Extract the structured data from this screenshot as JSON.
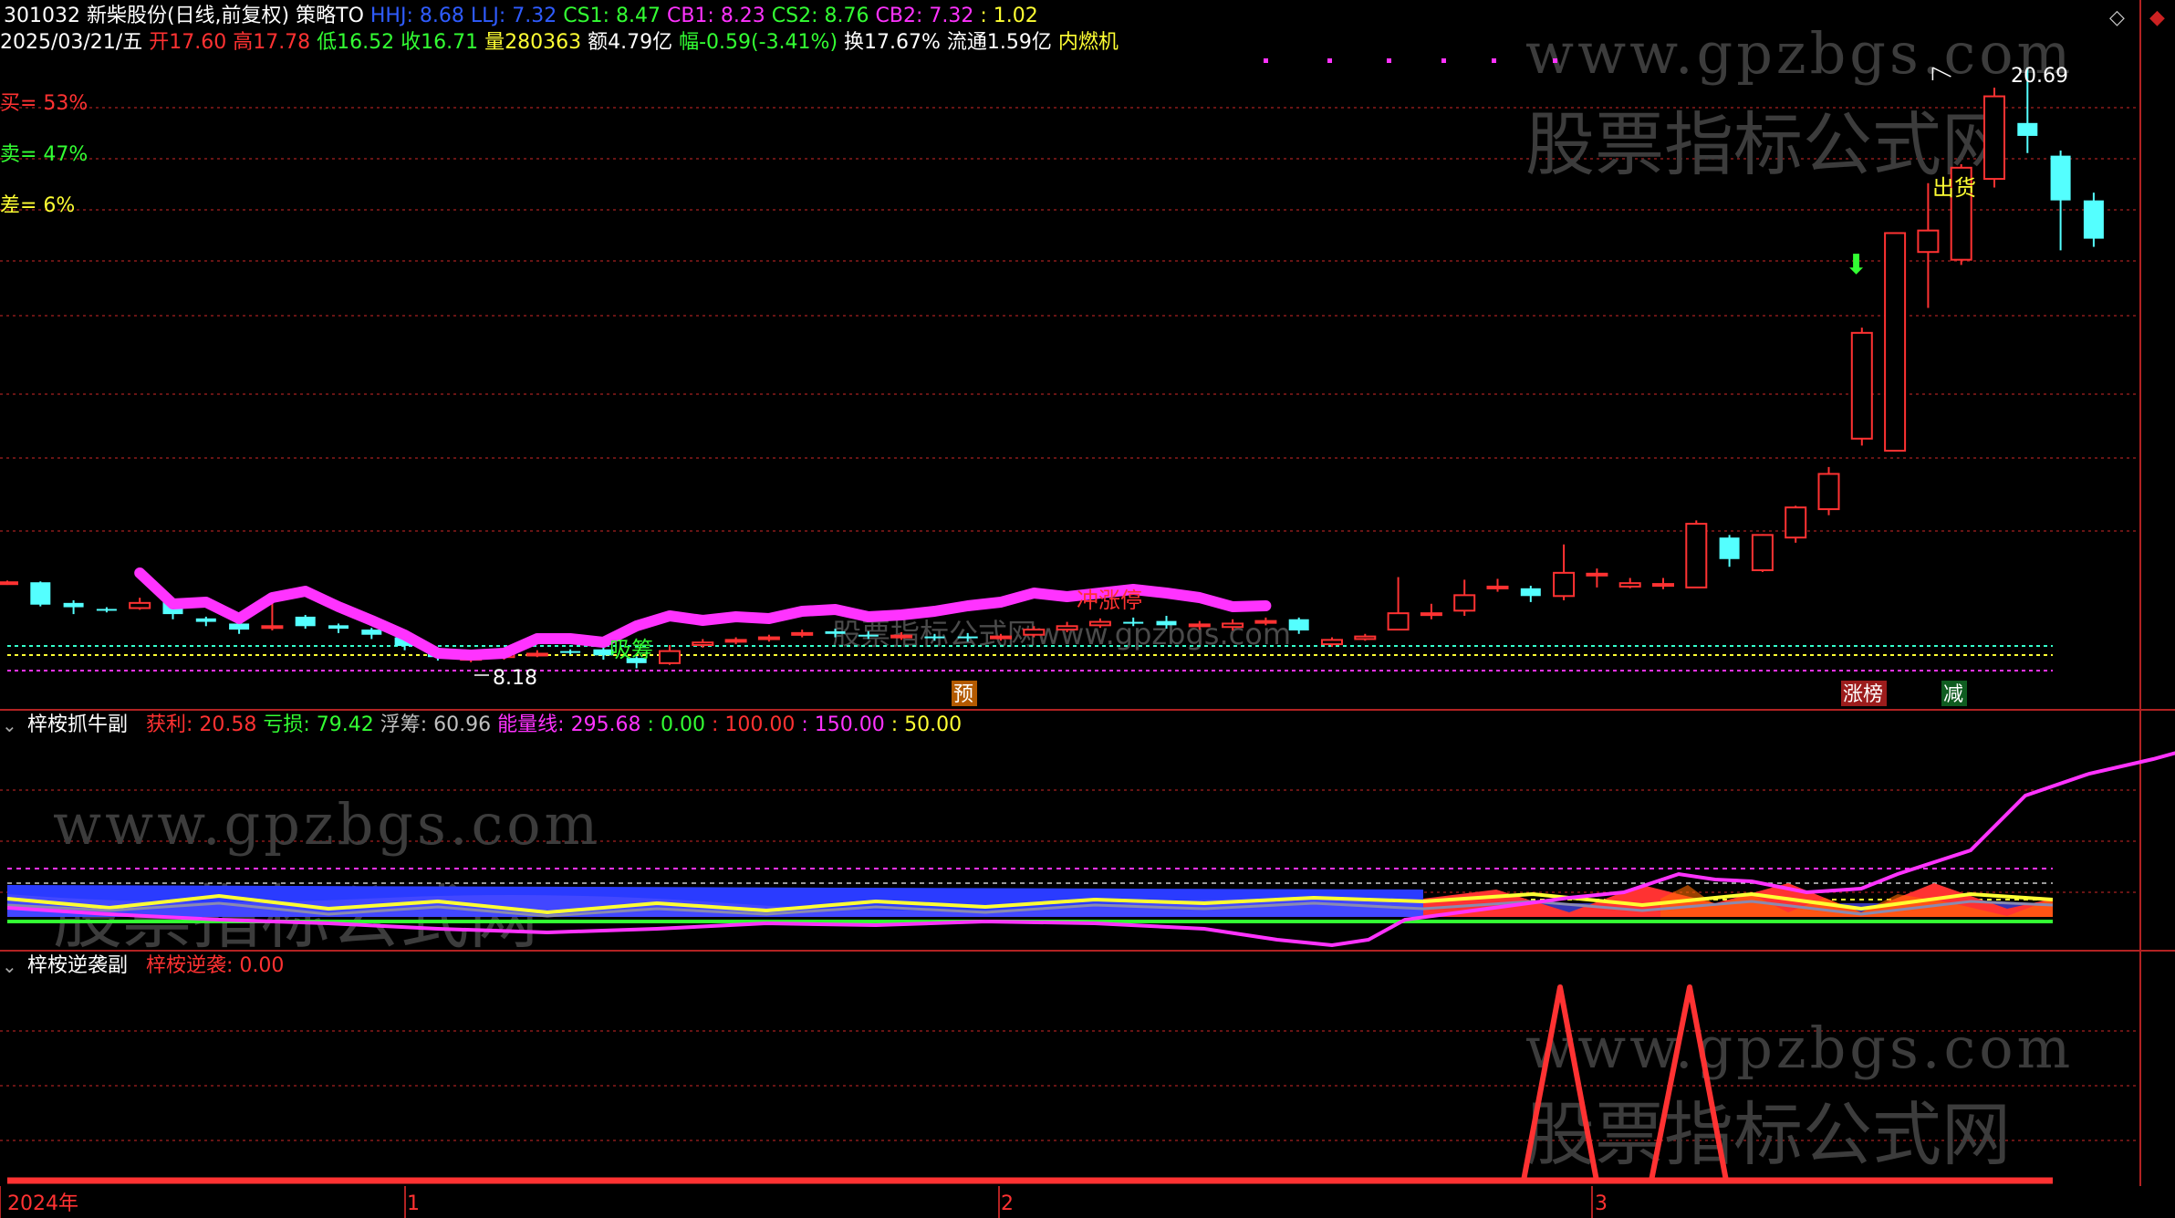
{
  "colors": {
    "up": "#ff3232",
    "down": "#54ffff",
    "grid": "#8b1a1a",
    "axis": "#b22222",
    "magenta": "#ff33ff",
    "yellow": "#ffff33",
    "green": "#33ff33",
    "blue": "#2a3bff",
    "white": "#ffffff",
    "watermark": "#3c3c3c"
  },
  "header": {
    "line1": [
      {
        "text": "301032 新柴股份(日线,前复权)",
        "color": "#ffffff"
      },
      {
        "text": "策略TO",
        "color": "#ffffff"
      },
      {
        "text": "HHJ: 8.68",
        "color": "#2f5cff"
      },
      {
        "text": "LLJ: 7.32",
        "color": "#2f5cff"
      },
      {
        "text": "CS1: 8.47",
        "color": "#33ff33"
      },
      {
        "text": "CB1: 8.23",
        "color": "#ff33ff"
      },
      {
        "text": "CS2: 8.76",
        "color": "#33ff33"
      },
      {
        "text": "CB2: 7.32",
        "color": "#ff33ff"
      },
      {
        "text": ": 1.02",
        "color": "#ffff33"
      }
    ],
    "line2": [
      {
        "text": "2025/03/21/五",
        "color": "#ffffff"
      },
      {
        "text": "开17.60",
        "color": "#ff3232"
      },
      {
        "text": "高17.78",
        "color": "#ff3232"
      },
      {
        "text": "低16.52",
        "color": "#33ff33"
      },
      {
        "text": "收16.71",
        "color": "#33ff33"
      },
      {
        "text": "量280363",
        "color": "#ffff33"
      },
      {
        "text": "额4.79亿",
        "color": "#ffffff"
      },
      {
        "text": "幅-0.59(-3.41%)",
        "color": "#33ff33"
      },
      {
        "text": "换17.67%",
        "color": "#ffffff"
      },
      {
        "text": "流通1.59亿",
        "color": "#ffffff"
      },
      {
        "text": "内燃机",
        "color": "#ffff33"
      }
    ],
    "left_stats": [
      {
        "text": "买= 53%",
        "color": "#ff3232"
      },
      {
        "text": "卖= 47%",
        "color": "#33ff33"
      },
      {
        "text": "差= 6%",
        "color": "#ffff33"
      }
    ]
  },
  "panel2": {
    "title": "梓桉抓牛副",
    "items": [
      {
        "text": "获利: 20.58",
        "color": "#ff3232"
      },
      {
        "text": "亏损: 79.42",
        "color": "#33ff33"
      },
      {
        "text": "浮筹: 60.96",
        "color": "#c0c0c0"
      },
      {
        "text": "能量线: 295.68",
        "color": "#ff33ff"
      },
      {
        "text": ": 0.00",
        "color": "#33ff33"
      },
      {
        "text": ": 100.00",
        "color": "#ff3232"
      },
      {
        "text": ": 150.00",
        "color": "#ff33ff"
      },
      {
        "text": ": 50.00",
        "color": "#ffff33"
      }
    ]
  },
  "panel3": {
    "title": "梓桉逆袭副",
    "items": [
      {
        "text": "梓桉逆袭: 0.00",
        "color": "#ff3232"
      }
    ]
  },
  "labels": {
    "max_price": "20.69",
    "min_price": "8.18",
    "chu_huo": "出货",
    "ji_zhang_ting": "冲涨停",
    "xi_shou": "吸筹",
    "yu": "预",
    "zhang_bang": "涨榜",
    "jian": "减",
    "inline_watermark": "股票指标公式网www.gpzbgs.com"
  },
  "watermarks": {
    "url": "www.gpzbgs.com",
    "cn": "股票指标公式网"
  },
  "x_axis": {
    "labels": [
      {
        "text": "2024年",
        "index": 0
      },
      {
        "text": "1",
        "index": 12
      },
      {
        "text": "2",
        "index": 30
      },
      {
        "text": "3",
        "index": 48
      }
    ]
  },
  "chart_data": {
    "type": "candlestick",
    "candles": [
      {
        "o": 8.7,
        "c": 8.72,
        "h": 8.76,
        "l": 8.66
      },
      {
        "o": 8.72,
        "c": 8.2,
        "h": 8.74,
        "l": 8.16
      },
      {
        "o": 8.24,
        "c": 8.14,
        "h": 8.3,
        "l": 7.98
      },
      {
        "o": 8.1,
        "c": 8.08,
        "h": 8.14,
        "l": 8.02
      },
      {
        "o": 8.12,
        "c": 8.24,
        "h": 8.36,
        "l": 8.08
      },
      {
        "o": 8.34,
        "c": 7.98,
        "h": 8.36,
        "l": 7.86
      },
      {
        "o": 7.88,
        "c": 7.8,
        "h": 7.92,
        "l": 7.7
      },
      {
        "o": 7.76,
        "c": 7.62,
        "h": 7.8,
        "l": 7.52
      },
      {
        "o": 7.66,
        "c": 7.7,
        "h": 8.36,
        "l": 7.6
      },
      {
        "o": 7.92,
        "c": 7.7,
        "h": 7.96,
        "l": 7.64
      },
      {
        "o": 7.72,
        "c": 7.64,
        "h": 7.76,
        "l": 7.54
      },
      {
        "o": 7.62,
        "c": 7.5,
        "h": 7.66,
        "l": 7.4
      },
      {
        "o": 7.44,
        "c": 7.24,
        "h": 7.48,
        "l": 7.14
      },
      {
        "o": 7.08,
        "c": 6.98,
        "h": 7.12,
        "l": 6.9
      },
      {
        "o": 6.92,
        "c": 6.96,
        "h": 7.06,
        "l": 6.86
      },
      {
        "o": 6.98,
        "c": 7.04,
        "h": 7.12,
        "l": 6.92
      },
      {
        "o": 7.06,
        "c": 7.06,
        "h": 7.14,
        "l": 6.98
      },
      {
        "o": 7.12,
        "c": 7.1,
        "h": 7.16,
        "l": 7.04
      },
      {
        "o": 7.16,
        "c": 7.02,
        "h": 7.22,
        "l": 6.92
      },
      {
        "o": 6.96,
        "c": 6.84,
        "h": 7.0,
        "l": 6.72
      },
      {
        "o": 6.84,
        "c": 7.12,
        "h": 7.26,
        "l": 6.8
      },
      {
        "o": 7.26,
        "c": 7.32,
        "h": 7.4,
        "l": 7.2
      },
      {
        "o": 7.34,
        "c": 7.38,
        "h": 7.44,
        "l": 7.28
      },
      {
        "o": 7.4,
        "c": 7.44,
        "h": 7.5,
        "l": 7.34
      },
      {
        "o": 7.5,
        "c": 7.54,
        "h": 7.62,
        "l": 7.44
      },
      {
        "o": 7.58,
        "c": 7.52,
        "h": 7.64,
        "l": 7.44
      },
      {
        "o": 7.5,
        "c": 7.46,
        "h": 7.58,
        "l": 7.4
      },
      {
        "o": 7.44,
        "c": 7.48,
        "h": 7.56,
        "l": 7.38
      },
      {
        "o": 7.46,
        "c": 7.44,
        "h": 7.52,
        "l": 7.36
      },
      {
        "o": 7.46,
        "c": 7.42,
        "h": 7.54,
        "l": 7.34
      },
      {
        "o": 7.42,
        "c": 7.46,
        "h": 7.52,
        "l": 7.36
      },
      {
        "o": 7.5,
        "c": 7.62,
        "h": 7.7,
        "l": 7.44
      },
      {
        "o": 7.62,
        "c": 7.7,
        "h": 7.8,
        "l": 7.56
      },
      {
        "o": 7.72,
        "c": 7.8,
        "h": 7.88,
        "l": 7.66
      },
      {
        "o": 7.8,
        "c": 7.76,
        "h": 7.9,
        "l": 7.7
      },
      {
        "o": 7.82,
        "c": 7.72,
        "h": 7.94,
        "l": 7.64
      },
      {
        "o": 7.7,
        "c": 7.74,
        "h": 7.82,
        "l": 7.62
      },
      {
        "o": 7.68,
        "c": 7.76,
        "h": 7.86,
        "l": 7.6
      },
      {
        "o": 7.78,
        "c": 7.82,
        "h": 7.9,
        "l": 7.72
      },
      {
        "o": 7.86,
        "c": 7.6,
        "h": 7.9,
        "l": 7.52
      },
      {
        "o": 7.28,
        "c": 7.38,
        "h": 7.44,
        "l": 7.22
      },
      {
        "o": 7.4,
        "c": 7.46,
        "h": 7.52,
        "l": 7.36
      },
      {
        "o": 7.62,
        "c": 8.0,
        "h": 8.84,
        "l": 7.6
      },
      {
        "o": 8.0,
        "c": 8.0,
        "h": 8.22,
        "l": 7.86
      },
      {
        "o": 8.06,
        "c": 8.42,
        "h": 8.78,
        "l": 7.94
      },
      {
        "o": 8.6,
        "c": 8.62,
        "h": 8.8,
        "l": 8.5
      },
      {
        "o": 8.58,
        "c": 8.4,
        "h": 8.64,
        "l": 8.26
      },
      {
        "o": 8.4,
        "c": 8.94,
        "h": 9.6,
        "l": 8.3
      },
      {
        "o": 8.92,
        "c": 8.92,
        "h": 9.04,
        "l": 8.6
      },
      {
        "o": 8.62,
        "c": 8.7,
        "h": 8.82,
        "l": 8.58
      },
      {
        "o": 8.68,
        "c": 8.68,
        "h": 8.82,
        "l": 8.56
      },
      {
        "o": 8.6,
        "c": 10.08,
        "h": 10.16,
        "l": 8.6
      },
      {
        "o": 9.76,
        "c": 9.26,
        "h": 9.82,
        "l": 9.08
      },
      {
        "o": 9.0,
        "c": 9.82,
        "h": 9.84,
        "l": 8.96
      },
      {
        "o": 9.76,
        "c": 10.46,
        "h": 10.5,
        "l": 9.64
      },
      {
        "o": 10.42,
        "c": 11.24,
        "h": 11.4,
        "l": 10.28
      },
      {
        "o": 12.06,
        "c": 14.52,
        "h": 14.64,
        "l": 11.9
      },
      {
        "o": 11.78,
        "c": 16.84,
        "h": 16.84,
        "l": 11.78
      },
      {
        "o": 16.4,
        "c": 16.9,
        "h": 18.0,
        "l": 15.1
      },
      {
        "o": 16.22,
        "c": 18.36,
        "h": 18.44,
        "l": 16.1
      },
      {
        "o": 18.1,
        "c": 20.02,
        "h": 20.22,
        "l": 17.9
      },
      {
        "o": 19.4,
        "c": 19.1,
        "h": 20.69,
        "l": 18.7
      },
      {
        "o": 18.64,
        "c": 17.6,
        "h": 18.76,
        "l": 16.44
      },
      {
        "o": 17.6,
        "c": 16.71,
        "h": 17.78,
        "l": 16.52
      }
    ]
  }
}
